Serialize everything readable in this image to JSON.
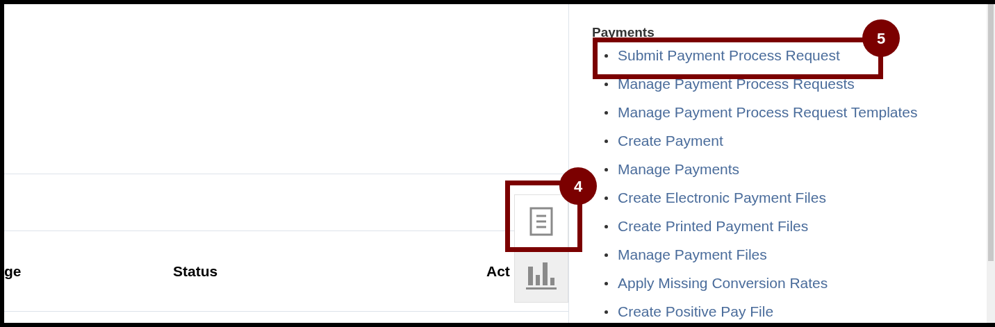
{
  "table": {
    "columns": [
      "ge",
      "Status",
      "Act"
    ]
  },
  "side_tabs": [
    {
      "kind": "document",
      "selected": true
    },
    {
      "kind": "chart",
      "selected": false
    }
  ],
  "payments": {
    "heading": "Payments",
    "links": [
      "Submit Payment Process Request",
      "Manage Payment Process Requests",
      "Manage Payment Process Request Templates",
      "Create Payment",
      "Manage Payments",
      "Create Electronic Payment Files",
      "Create Printed Payment Files",
      "Manage Payment Files",
      "Apply Missing Conversion Rates",
      "Create Positive Pay File"
    ]
  },
  "callouts": [
    {
      "label": "4"
    },
    {
      "label": "5"
    }
  ]
}
